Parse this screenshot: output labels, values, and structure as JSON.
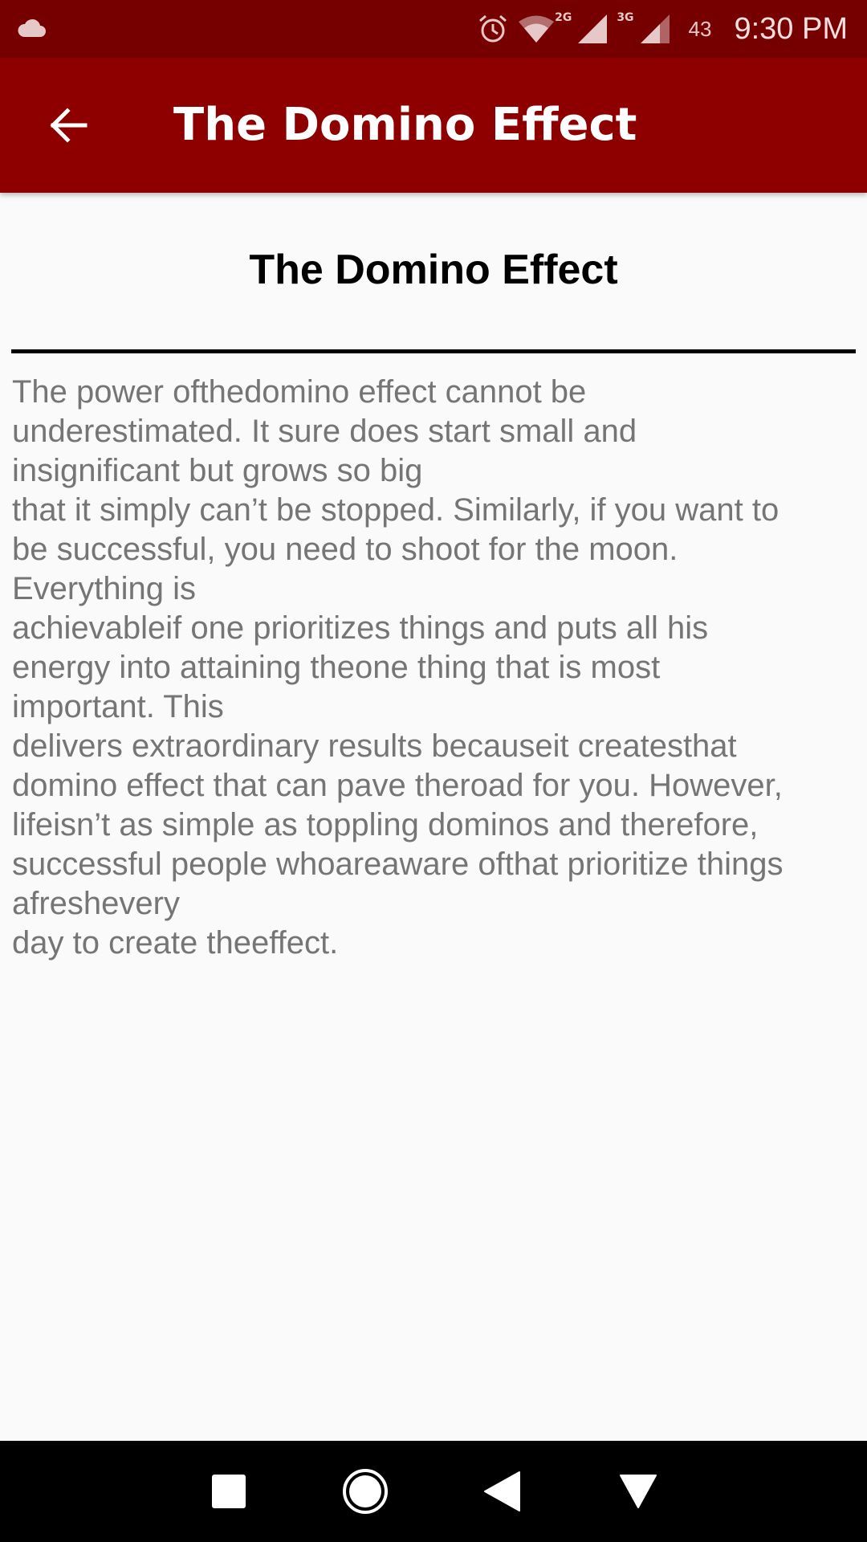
{
  "status_bar": {
    "network_2g_label": "2G",
    "network_3g_label": "3G",
    "battery": "43",
    "time": "9:30 PM",
    "icons": [
      "cloud-icon",
      "alarm-icon",
      "wifi-icon",
      "signal-2g-icon",
      "signal-3g-icon"
    ]
  },
  "app_bar": {
    "title": "The Domino Effect",
    "back_icon": "arrow-back-icon"
  },
  "article": {
    "title": "The Domino Effect",
    "body": "The power ofthedomino  effect cannot be\nunderestimated. It sure  does start small  and\ninsignificant but  grows so big\nthat it  simply  can’t be stopped.  Similarly,  if  you  want to\nbe successful, you need to shoot  for the moon.\nEverything is\nachievableif  one prioritizes  things and puts  all  his\nenergy  into attaining  theone thing that is most\nimportant. This\ndelivers  extraordinary  results  becauseit  createsthat\ndomino  effect that can pave theroad  for you. However,\nlifeisn’t as  simple  as  toppling dominos  and therefore,\nsuccessful  people  whoareaware ofthat prioritize  things\nafreshevery\nday  to create theeffect."
  },
  "nav_bar": {
    "icons": [
      "recents-square-icon",
      "home-circle-icon",
      "back-triangle-icon",
      "notification-down-icon"
    ]
  },
  "colors": {
    "status_bar": "#760000",
    "app_bar": "#8e0000",
    "background": "#fafafa",
    "body_text": "#757575",
    "nav_bar": "#000000"
  }
}
